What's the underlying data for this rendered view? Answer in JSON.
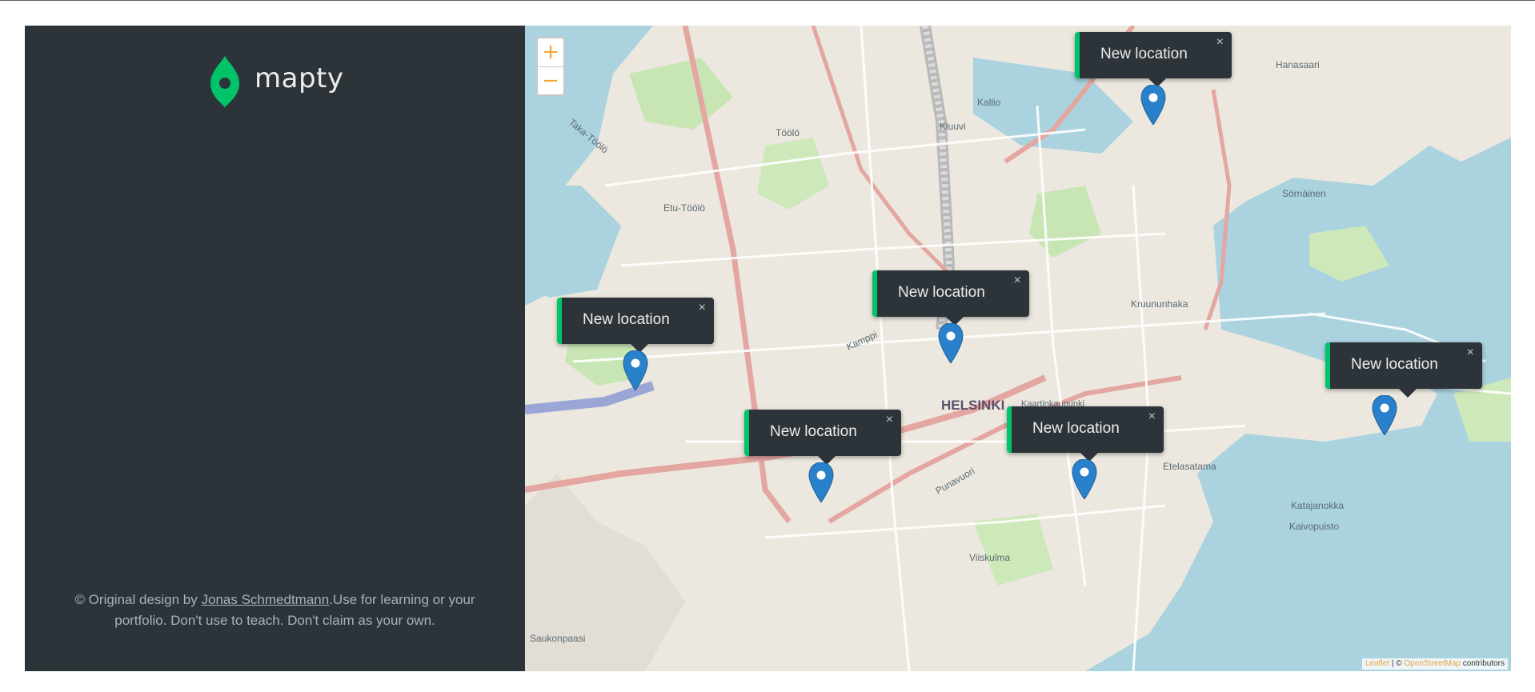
{
  "brand": {
    "name": "mapty",
    "logo_color": "#00c46a"
  },
  "copyright": {
    "prefix": "© Original design by ",
    "author": "Jonas Schmedtmann",
    "suffix": ".Use for learning or your portfolio. Don't use to teach. Don't claim as your own."
  },
  "map": {
    "zoom_in": "+",
    "zoom_out": "−",
    "attribution": {
      "leaflet": "Leaflet",
      "sep": " | © ",
      "osm": "OpenStreetMap",
      "contributors": " contributors"
    },
    "place_labels": [
      "HELSINKI",
      "Kallio",
      "Kluuvi",
      "Töölö",
      "Etu-Töölö",
      "Taka-Töölö",
      "Kamppi",
      "Punavuori",
      "Viiskulma",
      "Kruununhaka",
      "Katajanokka",
      "Kaivopuisto",
      "Etelasatama",
      "Hanasaari",
      "Sörnäinen",
      "Saukonpaasi",
      "Kaartinkaupunki"
    ],
    "popups": [
      {
        "label": "New location",
        "close": "×"
      },
      {
        "label": "New location",
        "close": "×"
      },
      {
        "label": "New location",
        "close": "×"
      },
      {
        "label": "New location",
        "close": "×"
      },
      {
        "label": "New location",
        "close": "×"
      },
      {
        "label": "New location",
        "close": "×"
      }
    ]
  },
  "colors": {
    "sidebar_bg": "#2d3439",
    "accent_green": "#00c46a",
    "water": "#aad3df",
    "land": "#e8e4dc",
    "marker_blue": "#2a81cb"
  }
}
